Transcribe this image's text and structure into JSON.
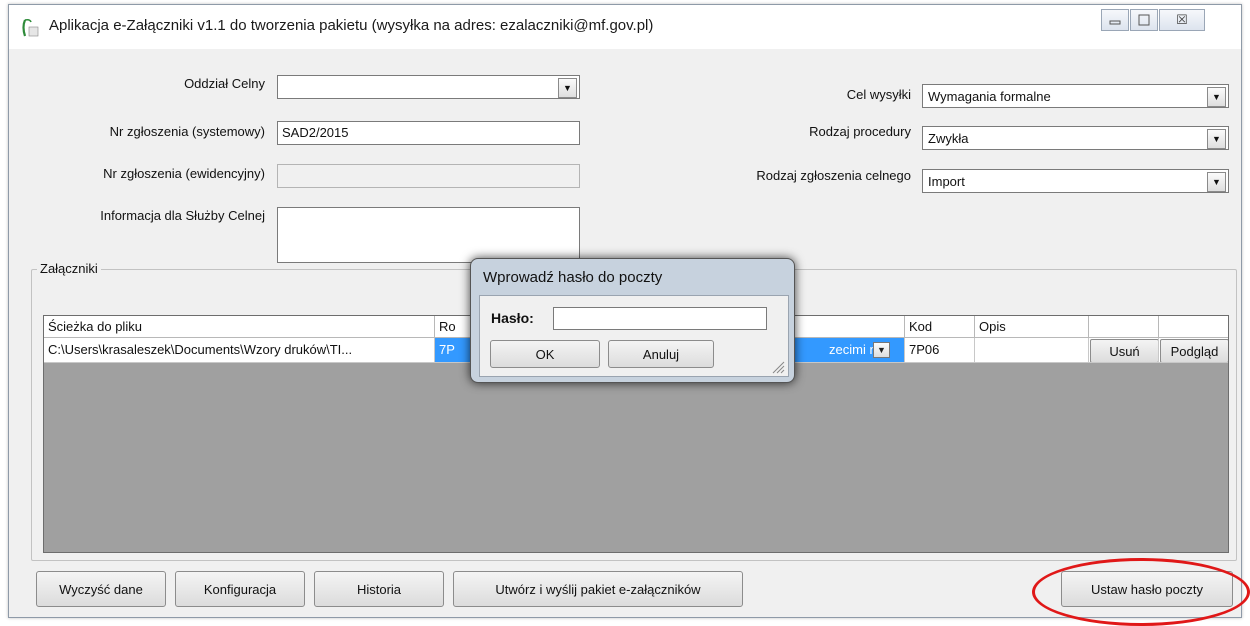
{
  "window": {
    "title": "Aplikacja e-Załączniki v1.1 do tworzenia pakietu (wysyłka na adres: ezalaczniki@mf.gov.pl)",
    "controls": [
      "minimize-icon",
      "maximize-icon",
      "close-icon"
    ],
    "close_glyph": "☒",
    "app_icon": "document-icon"
  },
  "form": {
    "oddzial_label": "Oddział Celny",
    "oddzial_value": "",
    "nr_sys_label": "Nr zgłoszenia (systemowy)",
    "nr_sys_value": "SAD2/2015",
    "nr_ewid_label": "Nr zgłoszenia (ewidencyjny)",
    "nr_ewid_value": "",
    "info_label": "Informacja dla Służby Celnej",
    "info_value": "",
    "cel_label": "Cel wysyłki",
    "cel_value": "Wymagania formalne",
    "procedura_label": "Rodzaj procedury",
    "procedura_value": "Zwykła",
    "zgloszenie_label": "Rodzaj zgłoszenia celnego",
    "zgloszenie_value": "Import"
  },
  "attachments": {
    "group_title": "Załączniki",
    "columns": {
      "path": "Ścieżka do pliku",
      "type": "Ro",
      "kod": "Kod",
      "opis": "Opis"
    },
    "row": {
      "path": "C:\\Users\\krasaleszek\\Documents\\Wzory druków\\TI...",
      "type_left": "7P",
      "type_right": "zecimi n...",
      "kod": "7P06",
      "opis": "",
      "delete_label": "Usuń",
      "preview_label": "Podgląd"
    }
  },
  "buttons": {
    "clear": "Wyczyść dane",
    "config": "Konfiguracja",
    "history": "Historia",
    "create_send": "Utwórz i wyślij pakiet e-załączników",
    "set_password": "Ustaw hasło poczty"
  },
  "dialog": {
    "title": "Wprowadź hasło do poczty",
    "password_label": "Hasło:",
    "password_value": "",
    "ok_label": "OK",
    "cancel_label": "Anuluj"
  },
  "colors": {
    "selection": "#3399ff",
    "highlight": "#e01818",
    "grid_background": "#a0a0a0"
  }
}
